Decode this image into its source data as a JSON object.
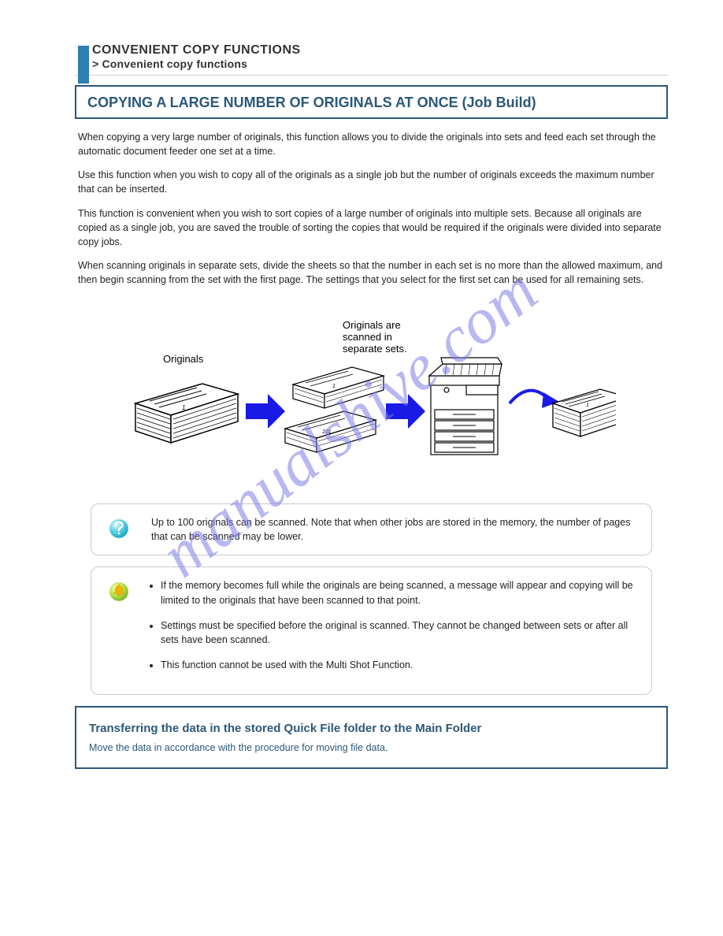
{
  "header": {
    "line1": "CONVENIENT COPY FUNCTIONS",
    "line2": "> Convenient copy functions"
  },
  "section": {
    "title": "COPYING A LARGE NUMBER OF ORIGINALS AT ONCE (Job Build)",
    "p1": "When copying a very large number of originals, this function allows you to divide the originals into sets and feed each set through the automatic document feeder one set at a time.",
    "p2": "Use this function when you wish to copy all of the originals as a single job but the number of originals exceeds the maximum number that can be inserted.",
    "p3": "This function is convenient when you wish to sort copies of a large number of originals into multiple sets. Because all originals are copied as a single job, you are saved the trouble of sorting the copies that would be required if the originals were divided into separate copy jobs.",
    "p4": "When scanning originals in separate sets, divide the sheets so that the number in each set is no more than the allowed maximum, and then begin scanning from the set with the first page. The settings that you select for the first set can be used for all remaining sets."
  },
  "figure": {
    "label_originals": "Originals",
    "label_scanned": "Originals are\nscanned in\nseparate sets."
  },
  "infobox": {
    "text": "Up to 100 originals can be scanned. Note that when other jobs are stored in the memory, the number of pages that can be scanned may be lower."
  },
  "bullets": [
    "If the memory becomes full while the originals are being scanned, a message will appear and copying will be limited to the originals that have been scanned to that point.",
    "Settings must be specified before the original is scanned. They cannot be changed between sets or after all sets have been scanned.",
    "This function cannot be used with the Multi Shot Function."
  ],
  "footer": {
    "title": "Transferring the data in the stored Quick File folder to the Main Folder",
    "sub": "Move the data in accordance with the procedure for moving file data."
  },
  "watermark": "manualshive.com"
}
